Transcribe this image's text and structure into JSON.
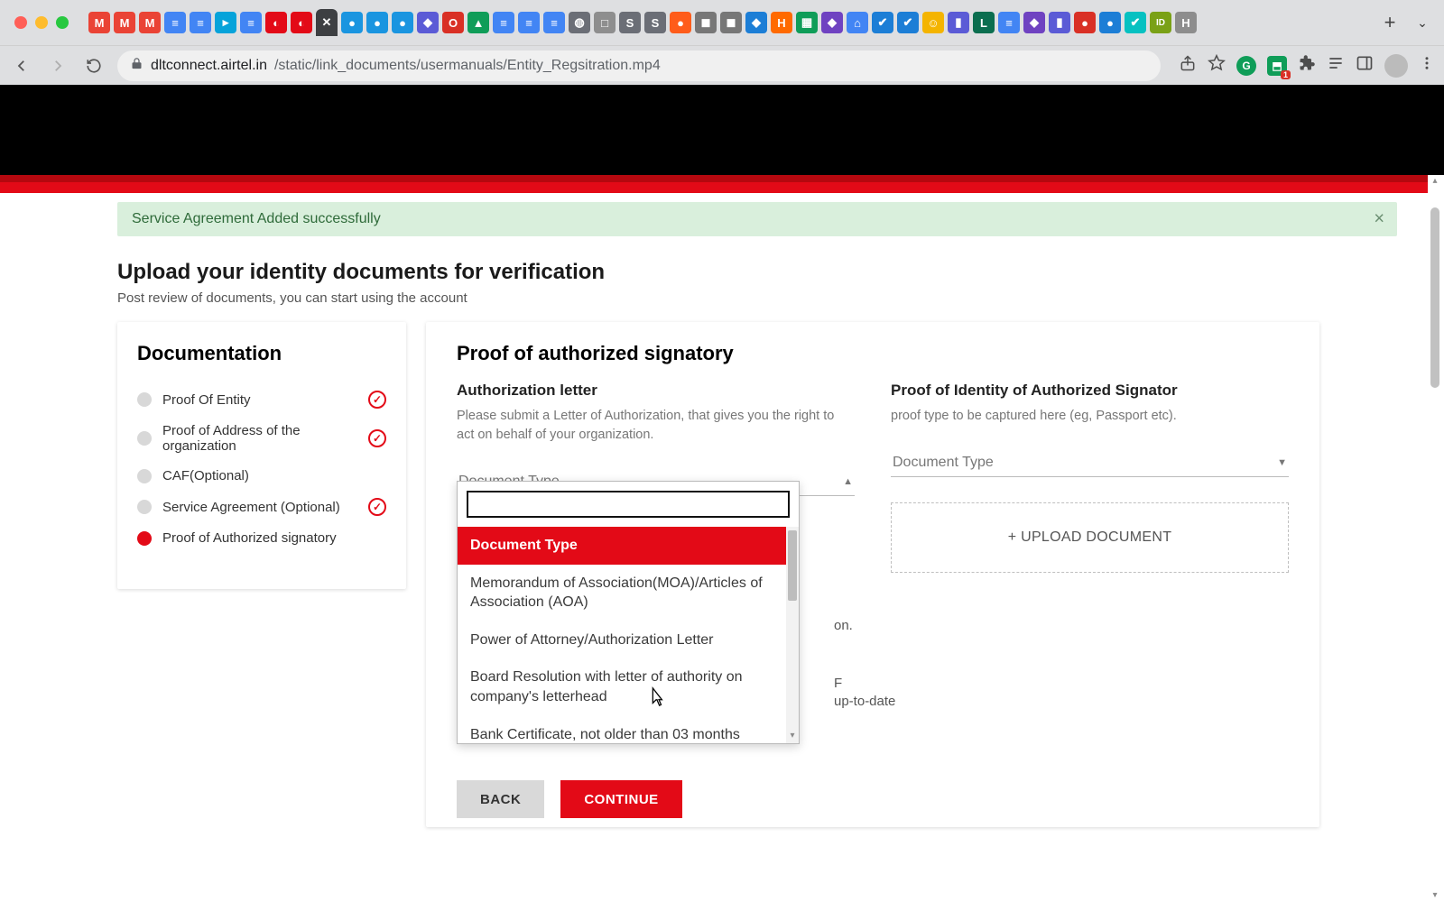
{
  "url": {
    "domain": "dltconnect.airtel.in",
    "path": "/static/link_documents/usermanuals/Entity_Regsitration.mp4"
  },
  "tabs": [
    {
      "icon": "M",
      "bg": "#ea4335"
    },
    {
      "icon": "M",
      "bg": "#ea4335"
    },
    {
      "icon": "M",
      "bg": "#ea4335"
    },
    {
      "icon": "≡",
      "bg": "#4285f4"
    },
    {
      "icon": "≡",
      "bg": "#4285f4"
    },
    {
      "icon": "▸",
      "bg": "#06a3da"
    },
    {
      "icon": "≡",
      "bg": "#4285f4"
    },
    {
      "icon": "◐",
      "bg": "#e30a17"
    },
    {
      "icon": "◐",
      "bg": "#e30a17"
    },
    {
      "icon": "✕",
      "bg": "#3d3f42",
      "active": true
    },
    {
      "icon": "●",
      "bg": "#1a95e0"
    },
    {
      "icon": "●",
      "bg": "#1a95e0"
    },
    {
      "icon": "●",
      "bg": "#1a95e0"
    },
    {
      "icon": "◆",
      "bg": "#5b5bd6"
    },
    {
      "icon": "O",
      "bg": "#d93025"
    },
    {
      "icon": "▲",
      "bg": "#0f9d58"
    },
    {
      "icon": "≡",
      "bg": "#4285f4"
    },
    {
      "icon": "≡",
      "bg": "#4285f4"
    },
    {
      "icon": "≡",
      "bg": "#4285f4"
    },
    {
      "icon": "◍",
      "bg": "#6b6e76"
    },
    {
      "icon": "□",
      "bg": "#8e8e8e"
    },
    {
      "icon": "S",
      "bg": "#6b6e76"
    },
    {
      "icon": "S",
      "bg": "#6b6e76"
    },
    {
      "icon": "●",
      "bg": "#ff5c1a"
    },
    {
      "icon": "◼",
      "bg": "#777"
    },
    {
      "icon": "◼",
      "bg": "#777"
    },
    {
      "icon": "◆",
      "bg": "#1c7ed6"
    },
    {
      "icon": "H",
      "bg": "#ff6a00"
    },
    {
      "icon": "▦",
      "bg": "#0f9d58"
    },
    {
      "icon": "◆",
      "bg": "#6f42c1"
    },
    {
      "icon": "⌂",
      "bg": "#4285f4"
    },
    {
      "icon": "✔",
      "bg": "#1c7ed6"
    },
    {
      "icon": "✔",
      "bg": "#1c7ed6"
    },
    {
      "icon": "☺",
      "bg": "#f4b400"
    },
    {
      "icon": "▮",
      "bg": "#5b5bd6"
    },
    {
      "icon": "L",
      "bg": "#0b6e4f"
    },
    {
      "icon": "≡",
      "bg": "#4285f4"
    },
    {
      "icon": "◆",
      "bg": "#6f42c1"
    },
    {
      "icon": "▮",
      "bg": "#5b5bd6"
    },
    {
      "icon": "●",
      "bg": "#d93025"
    },
    {
      "icon": "●",
      "bg": "#1c7ed6"
    },
    {
      "icon": "✔",
      "bg": "#06c1c1"
    },
    {
      "icon": "ID",
      "bg": "#7aa116"
    },
    {
      "icon": "H",
      "bg": "#8d8d8d"
    }
  ],
  "alert": {
    "text": "Service Agreement Added successfully"
  },
  "header": {
    "title": "Upload your identity documents for verification",
    "subtitle": "Post review of documents, you can start using the account"
  },
  "sidebar": {
    "title": "Documentation",
    "steps": [
      {
        "label": "Proof Of Entity",
        "checked": true,
        "active": false
      },
      {
        "label": "Proof of Address of the organization",
        "checked": true,
        "active": false
      },
      {
        "label": "CAF(Optional)",
        "checked": false,
        "active": false
      },
      {
        "label": "Service Agreement (Optional)",
        "checked": true,
        "active": false
      },
      {
        "label": "Proof of Authorized signatory",
        "checked": false,
        "active": true
      }
    ]
  },
  "main": {
    "section_title": "Proof of authorized signatory",
    "left": {
      "heading": "Authorization letter",
      "hint": "Please submit a Letter of Authorization, that gives you the right to act on behalf of your organization.",
      "select_label": "Document Type"
    },
    "right": {
      "heading": "Proof of Identity of Authorized Signator",
      "hint": "proof type to be captured here (eg, Passport etc).",
      "select_label": "Document Type",
      "upload_label": "+ UPLOAD DOCUMENT"
    },
    "dropdown": {
      "placeholder_option": "Document Type",
      "options": [
        "Memorandum of Association(MOA)/Articles of Association (AOA)",
        "Power of Attorney/Authorization Letter",
        "Board Resolution with letter of authority on company's letterhead",
        "Bank Certificate, not older than 03 months"
      ]
    },
    "obscured_text": {
      "suffix1": "on.",
      "suffix2": "F",
      "suffix3": "up-to-date"
    },
    "buttons": {
      "back": "BACK",
      "continue": "CONTINUE"
    }
  }
}
